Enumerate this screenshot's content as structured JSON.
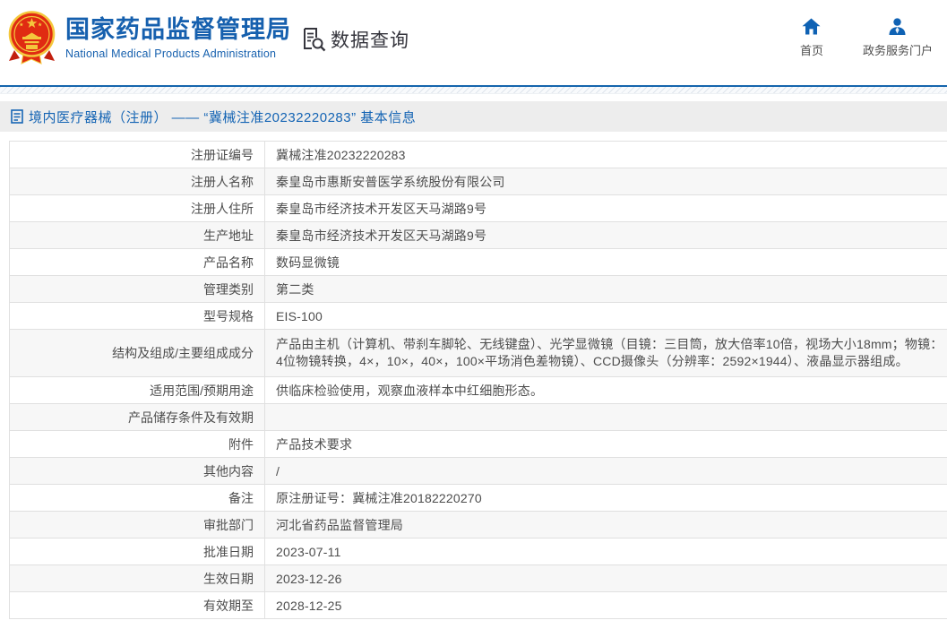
{
  "brand": {
    "title_cn": "国家药品监督管理局",
    "title_en": "National Medical Products Administration"
  },
  "header": {
    "section_title": "数据查询",
    "nav_home": "首页",
    "nav_portal": "政务服务门户"
  },
  "breadcrumb": {
    "text": "境内医疗器械（注册） —— “冀械注准20232220283” 基本信息"
  },
  "detail_table": {
    "rows": [
      {
        "label": "注册证编号",
        "value": "冀械注准20232220283"
      },
      {
        "label": "注册人名称",
        "value": "秦皇岛市惠斯安普医学系统股份有限公司"
      },
      {
        "label": "注册人住所",
        "value": "秦皇岛市经济技术开发区天马湖路9号"
      },
      {
        "label": "生产地址",
        "value": "秦皇岛市经济技术开发区天马湖路9号"
      },
      {
        "label": "产品名称",
        "value": "数码显微镜"
      },
      {
        "label": "管理类别",
        "value": "第二类"
      },
      {
        "label": "型号规格",
        "value": "EIS-100"
      },
      {
        "label": "结构及组成/主要组成成分",
        "value": "产品由主机（计算机、带刹车脚轮、无线键盘）、光学显微镜（目镜：三目筒，放大倍率10倍，视场大小18mm；物镜：4位物镜转换，4×，10×，40×，100×平场消色差物镜）、CCD摄像头（分辨率：2592×1944）、液晶显示器组成。",
        "tall": true
      },
      {
        "label": "适用范围/预期用途",
        "value": "供临床检验使用，观察血液样本中红细胞形态。"
      },
      {
        "label": "产品储存条件及有效期",
        "value": ""
      },
      {
        "label": "附件",
        "value": "产品技术要求"
      },
      {
        "label": "其他内容",
        "value": "/"
      },
      {
        "label": "备注",
        "value": "原注册证号：冀械注准20182220270"
      },
      {
        "label": "审批部门",
        "value": "河北省药品监督管理局"
      },
      {
        "label": "批准日期",
        "value": "2023-07-11"
      },
      {
        "label": "生效日期",
        "value": "2023-12-26"
      },
      {
        "label": "有效期至",
        "value": "2028-12-25"
      }
    ]
  },
  "colors": {
    "accent_blue": "#1464b4",
    "title_blue": "#1660ae",
    "emblem_red": "#e02b12",
    "emblem_gold": "#f4c73c",
    "dark_text": "#35353d",
    "row_alt_bg": "#f7f7f7",
    "breadcrumb_bg": "#ededed"
  }
}
